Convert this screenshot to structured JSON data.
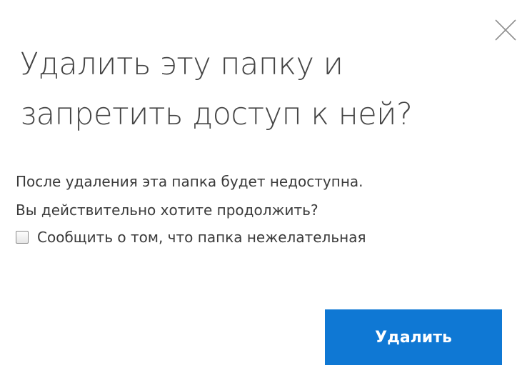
{
  "dialog": {
    "title_lines": [
      "Удалить эту папку и",
      "запретить доступ к ней?"
    ],
    "body_lines": [
      "После удаления эта папка будет недоступна.",
      "Вы действительно хотите продолжить?"
    ],
    "checkbox": {
      "label": "Сообщить о том, что папка нежелательная",
      "checked": false
    },
    "primary_button_label": "Удалить",
    "close_icon": "close-icon"
  },
  "colors": {
    "primary_button": "#0f78d4",
    "title_text": "#444444",
    "body_text": "#3a3a3a",
    "background": "#ffffff"
  }
}
